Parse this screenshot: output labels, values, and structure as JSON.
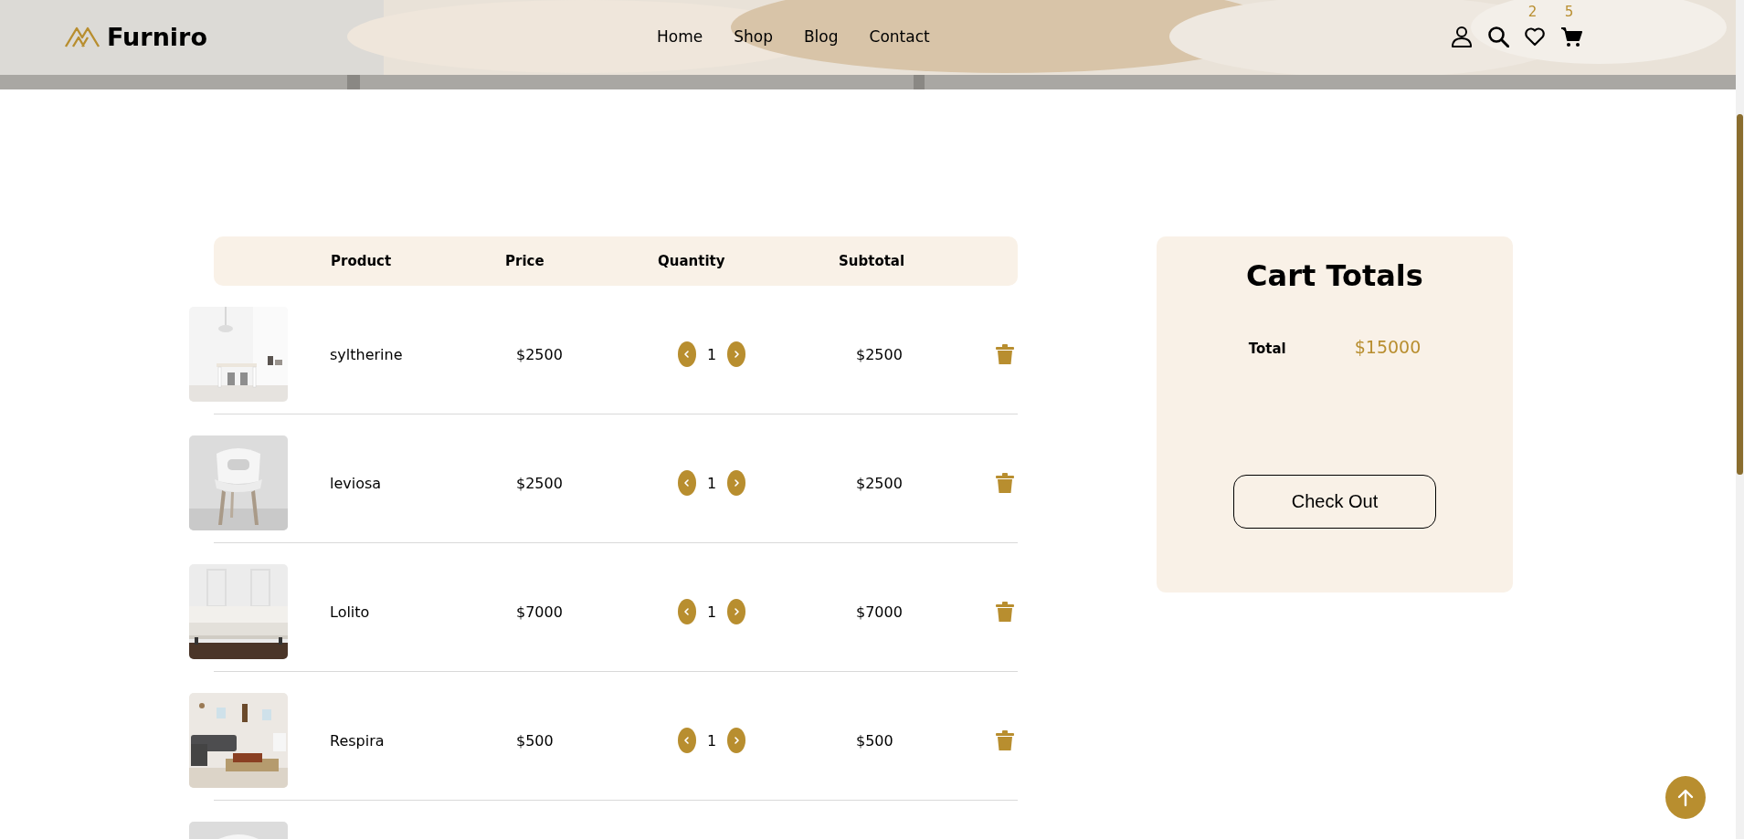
{
  "header": {
    "logo": "Furniro",
    "nav": [
      {
        "label": "Home"
      },
      {
        "label": "Shop"
      },
      {
        "label": "Blog"
      },
      {
        "label": "Contact"
      }
    ],
    "wishlist_count": "2",
    "cart_count": "5"
  },
  "table": {
    "columns": [
      "Product",
      "Price",
      "Quantity",
      "Subtotal"
    ],
    "rows": [
      {
        "product": "syltherine",
        "price": "$2500",
        "quantity": "1",
        "subtotal": "$2500"
      },
      {
        "product": "leviosa",
        "price": "$2500",
        "quantity": "1",
        "subtotal": "$2500"
      },
      {
        "product": "Lolito",
        "price": "$7000",
        "quantity": "1",
        "subtotal": "$7000"
      },
      {
        "product": "Respira",
        "price": "$500",
        "quantity": "1",
        "subtotal": "$500"
      }
    ]
  },
  "cart_totals": {
    "title": "Cart Totals",
    "total_label": "Total",
    "total_value": "$15000",
    "button": "Check Out"
  }
}
